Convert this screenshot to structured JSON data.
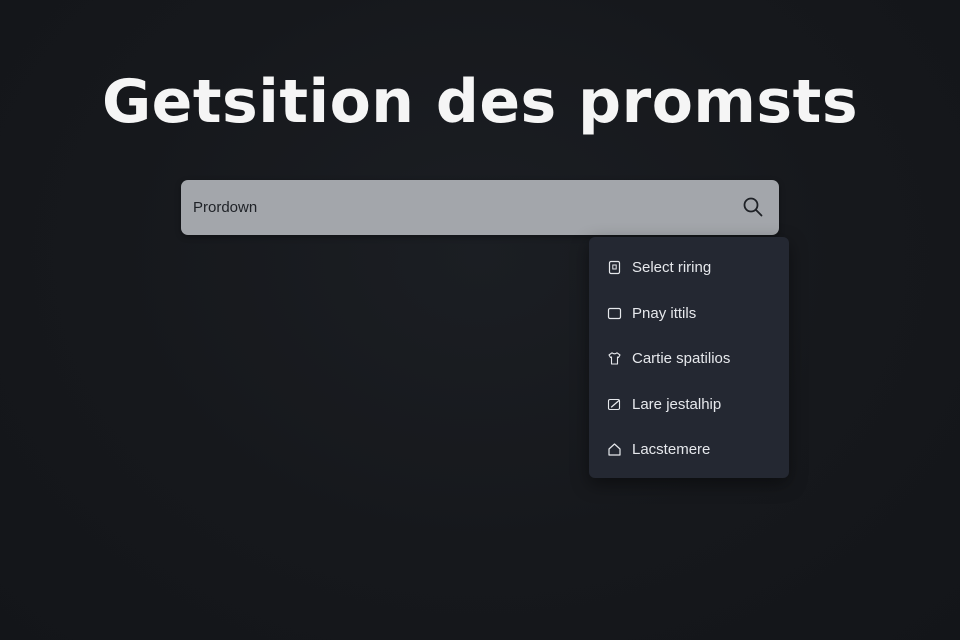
{
  "page": {
    "title": "Getsition des promsts"
  },
  "search": {
    "value": "Prordown",
    "icon": "search-icon"
  },
  "dropdown": {
    "items": [
      {
        "label": "Select riring",
        "icon": "document-lock-icon"
      },
      {
        "label": "Pnay ittils",
        "icon": "folder-icon"
      },
      {
        "label": "Cartie spatilios",
        "icon": "shirt-icon"
      },
      {
        "label": "Lare jestalhip",
        "icon": "edit-icon"
      },
      {
        "label": "Lacstemere",
        "icon": "home-icon"
      }
    ]
  },
  "colors": {
    "background": "#15171b",
    "search_bar": "#a3a6ab",
    "dropdown": "#242832",
    "text_light": "#f5f5f5"
  }
}
